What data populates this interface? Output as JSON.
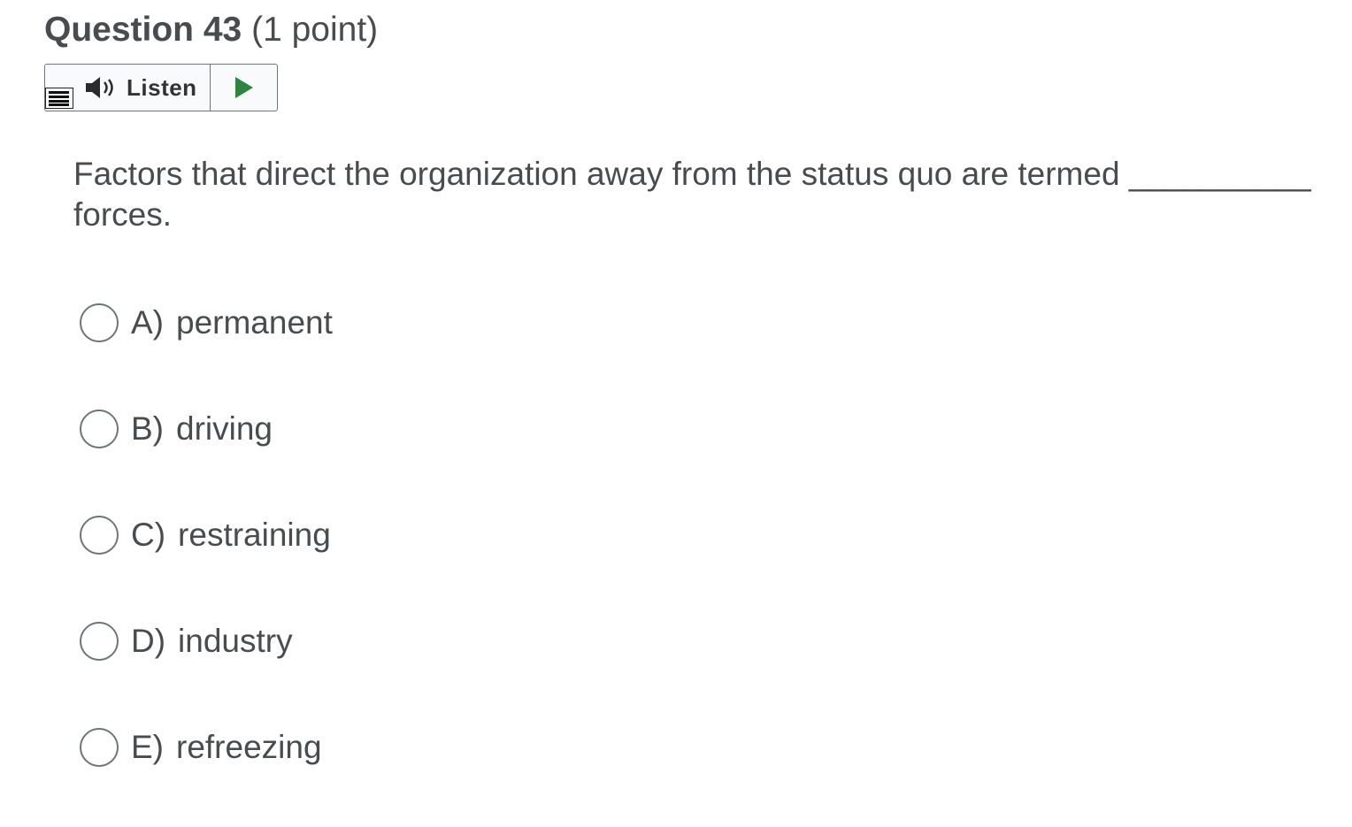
{
  "question": {
    "title": "Question 43",
    "points": "(1 point)"
  },
  "listen": {
    "label": "Listen",
    "icons": {
      "menu": "reader-menu-icon",
      "speaker": "speaker-icon",
      "play": "play-icon"
    },
    "play_color": "#2e8540"
  },
  "prompt": {
    "text": "Factors that direct the organization away from the status quo are termed __________ forces."
  },
  "choices": [
    {
      "letter": "A)",
      "text": "permanent"
    },
    {
      "letter": "B)",
      "text": "driving"
    },
    {
      "letter": "C)",
      "text": "restraining"
    },
    {
      "letter": "D)",
      "text": "industry"
    },
    {
      "letter": "E)",
      "text": "refreezing"
    }
  ]
}
